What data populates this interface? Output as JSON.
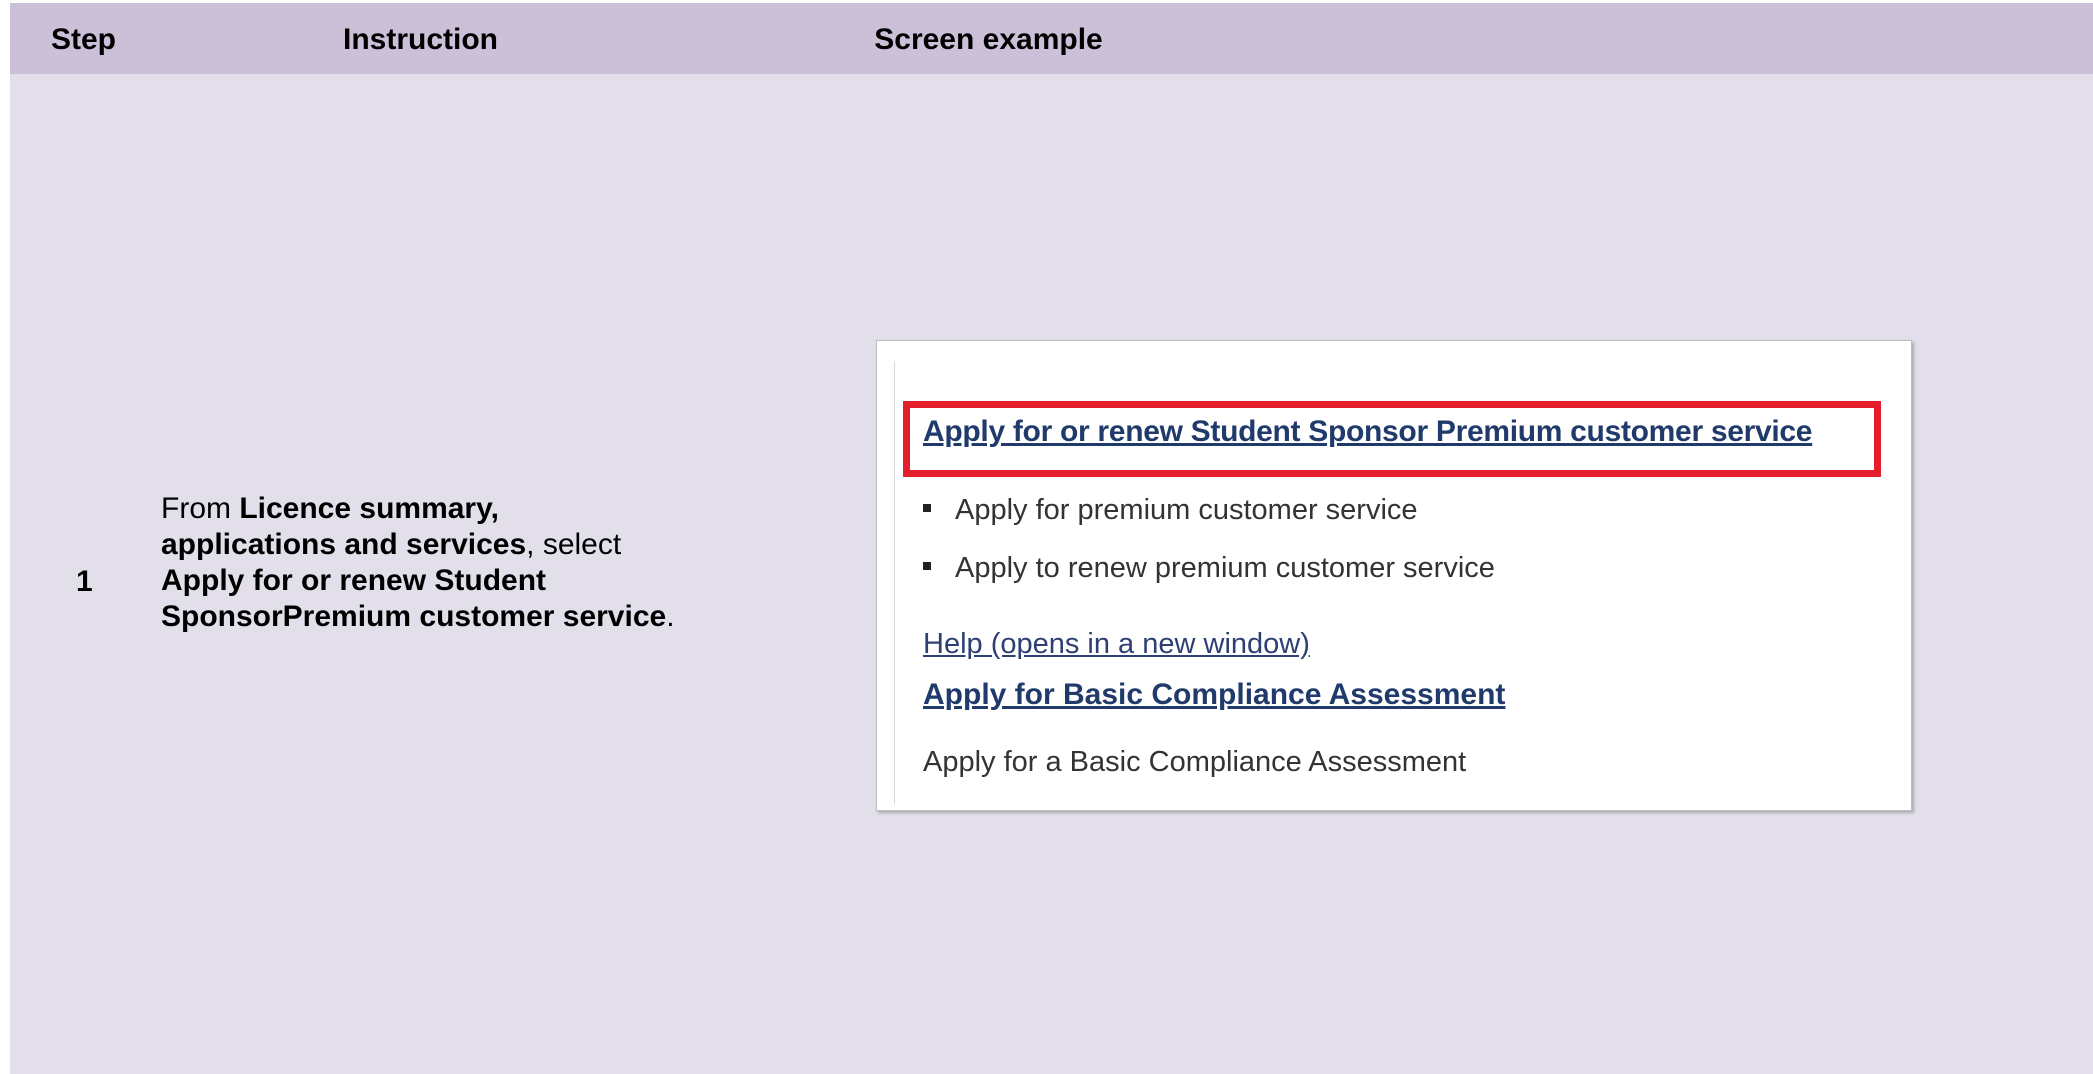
{
  "header": {
    "step": "Step",
    "instruction": "Instruction",
    "screen_example": "Screen example"
  },
  "row": {
    "step_number": "1",
    "instruction": {
      "t1": "From ",
      "b1": "Licence summary, applications and services",
      "t2": ", select ",
      "b2": "Apply for or renew Student SponsorPremium customer service",
      "t3": "."
    },
    "screen": {
      "main_link": "Apply for or renew Student Sponsor Premium customer service",
      "bullets": [
        "Apply for premium customer service",
        "Apply to renew premium customer service"
      ],
      "help_link": "Help (opens in a new window)",
      "bca_link": "Apply for Basic Compliance Assessment",
      "bca_text": "Apply for a Basic Compliance Assessment"
    }
  },
  "colors": {
    "header_bg": "#ccc0d9",
    "body_bg": "#e3dfea",
    "highlight": "#e41e2a",
    "link": "#1f3a6b"
  }
}
